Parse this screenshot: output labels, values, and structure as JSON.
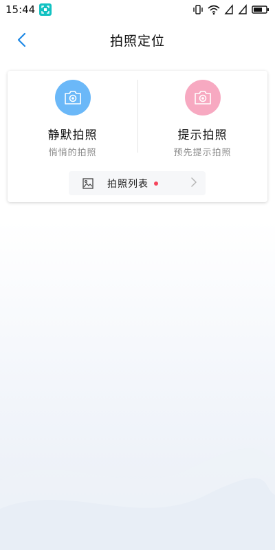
{
  "status_bar": {
    "time": "15:44",
    "icons": [
      "scan-app-icon",
      "vibrate-icon",
      "wifi-icon",
      "signal-icon",
      "signal-icon",
      "battery-icon"
    ]
  },
  "header": {
    "title": "拍照定位",
    "back_icon": "chevron-left-icon"
  },
  "options": [
    {
      "title": "静默拍照",
      "subtitle": "悄悄的拍照",
      "icon": "camera-icon",
      "color": "#6bb8f8"
    },
    {
      "title": "提示拍照",
      "subtitle": "预先提示拍照",
      "icon": "camera-icon",
      "color": "#f7a9c1"
    }
  ],
  "photo_list": {
    "label": "拍照列表",
    "icon": "image-icon",
    "badge_color": "#f5455c",
    "arrow": "chevron-right-icon"
  },
  "colors": {
    "accent": "#1e88e5"
  }
}
